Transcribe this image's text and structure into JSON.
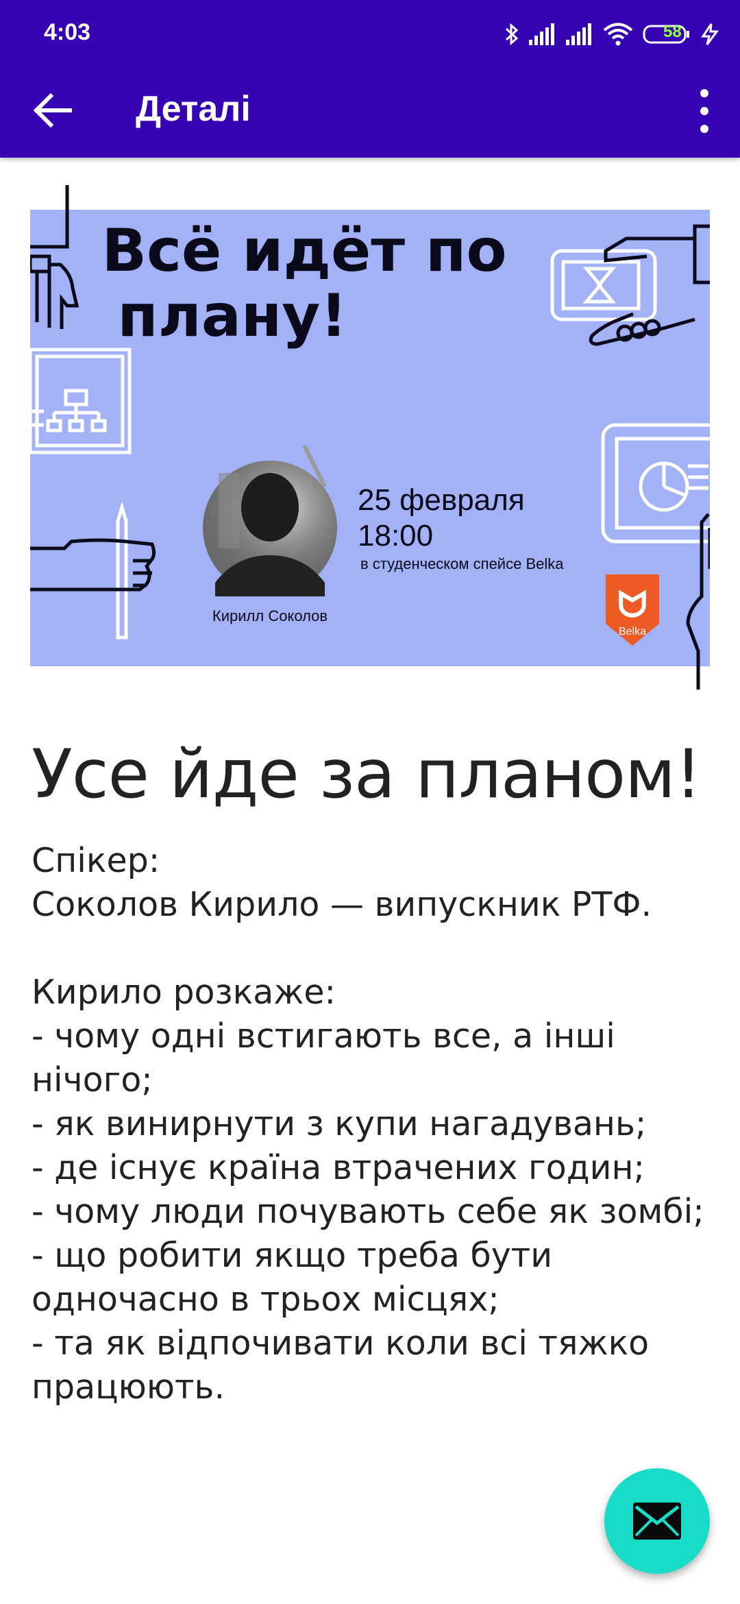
{
  "status_bar": {
    "time": "4:03",
    "battery": "58",
    "icons": [
      "bluetooth-icon",
      "signal-icon",
      "signal-icon",
      "wifi-icon",
      "battery-icon",
      "charging-icon"
    ]
  },
  "app_bar": {
    "title": "Деталі",
    "back_icon": "arrow-back-icon",
    "menu_icon": "more-vert-icon"
  },
  "banner": {
    "headline_line1": "Всё идёт по",
    "headline_line2": "плану!",
    "date": "25 февраля",
    "time": "18:00",
    "place": "в студенческом спейсе Belka",
    "speaker": "Кирилл Соколов",
    "logo_text": "Belka",
    "background_color": "#a3b1f7"
  },
  "event": {
    "title": "Усе йде за планом!",
    "description": "Спікер:\nСоколов Кирило — випускник РТФ.\n\nКирило розкаже:\n- чому одні встигають все, а інші нічого;\n- як винирнути з купи нагадувань;\n- де існує країна втрачених годин;\n- чому люди почувають себе як зомбі;\n- що робити якщо треба бути одночасно в трьох місцях;\n- та як відпочивати коли всі тяжко працюють."
  },
  "fab": {
    "icon": "mail-icon",
    "color": "#19dcc8"
  },
  "colors": {
    "primary": "#3604b3",
    "accent": "#19dcc8"
  }
}
